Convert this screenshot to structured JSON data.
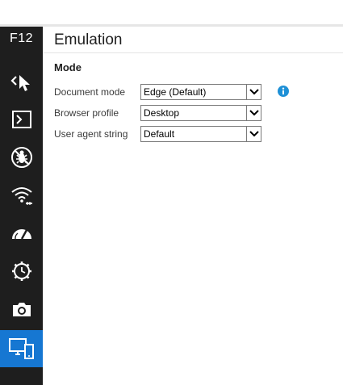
{
  "sidebar": {
    "shortcut": "F12",
    "tools": [
      {
        "icon": "dom-explorer-icon"
      },
      {
        "icon": "console-icon"
      },
      {
        "icon": "debugger-icon"
      },
      {
        "icon": "network-icon"
      },
      {
        "icon": "performance-icon"
      },
      {
        "icon": "memory-icon"
      },
      {
        "icon": "camera-icon"
      },
      {
        "icon": "emulation-icon"
      }
    ],
    "active_tool": "emulation-icon",
    "active_color": "#1677d2"
  },
  "panel": {
    "title": "Emulation",
    "section": "Mode",
    "fields": [
      {
        "label": "Document mode",
        "value": "Edge (Default)"
      },
      {
        "label": "Browser profile",
        "value": "Desktop"
      },
      {
        "label": "User agent string",
        "value": "Default"
      }
    ],
    "info_icon_color": "#1e90d6"
  }
}
